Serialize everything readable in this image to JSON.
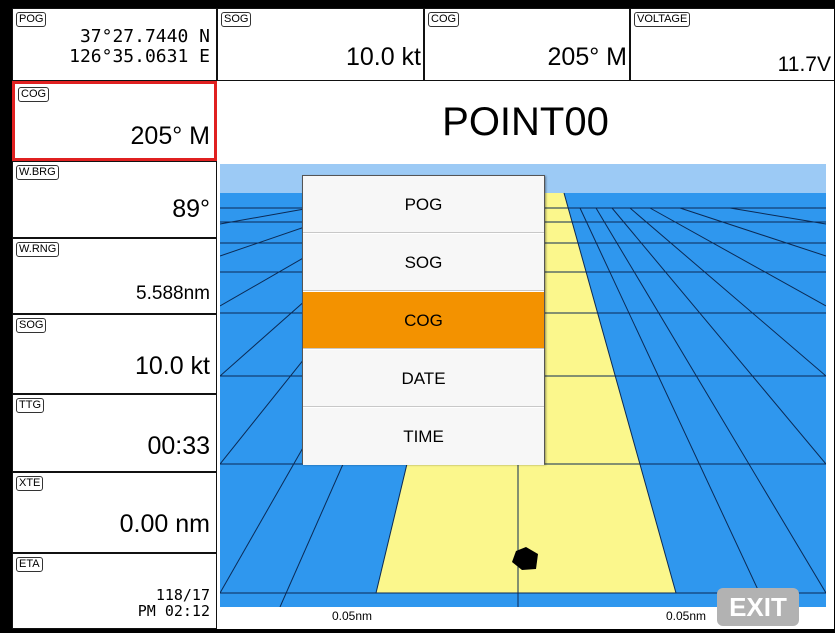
{
  "position_box": {
    "tag": "POG",
    "lat": "37°27.7440 N",
    "lon": "126°35.0631 E"
  },
  "top_bar": {
    "sog": {
      "tag": "SOG",
      "value": "10.0 kt"
    },
    "cog": {
      "tag": "COG",
      "value": "205° M"
    },
    "voltage": {
      "tag": "VOLTAGE",
      "value": "11.7V"
    }
  },
  "sidebar": {
    "cog": {
      "tag": "COG",
      "value": "205° M"
    },
    "wbrg": {
      "tag": "W.BRG",
      "value": "89°"
    },
    "wrng": {
      "tag": "W.RNG",
      "value": "5.588nm"
    },
    "sog": {
      "tag": "SOG",
      "value": "10.0 kt"
    },
    "ttg": {
      "tag": "TTG",
      "value": "00:33"
    },
    "xte": {
      "tag": "XTE",
      "value": "0.00 nm"
    },
    "eta": {
      "tag": "ETA",
      "date": "118/17",
      "time": "PM 02:12"
    }
  },
  "waypoint_title": "POINT00",
  "menu": {
    "items": [
      "POG",
      "SOG",
      "COG",
      "DATE",
      "TIME"
    ],
    "selected": "COG"
  },
  "scale": {
    "left": "0.05nm",
    "right": "0.05nm"
  },
  "exit_label": "EXIT",
  "colors": {
    "sky": "#9ccaf5",
    "water": "#2f97ee",
    "lane": "#fbf78c",
    "selected_menu": "#f39200",
    "selected_cell_border": "#e02020"
  }
}
